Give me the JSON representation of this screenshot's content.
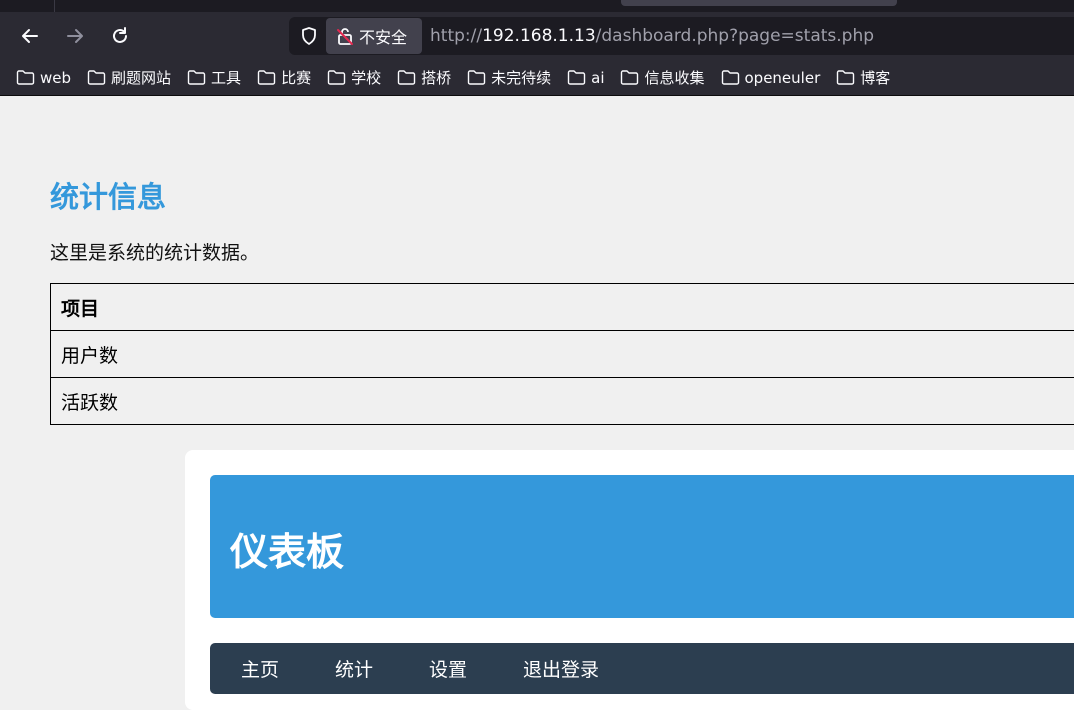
{
  "browser": {
    "url_label": "不安全",
    "url_scheme": "http://",
    "url_host": "192.168.1.13",
    "url_path": "/dashboard.php?page=stats.php",
    "colors": {
      "chrome": "#2b2a33",
      "urlbar": "#1c1b22",
      "text": "#fbfbfe"
    }
  },
  "bookmarks": [
    {
      "label": "web",
      "icon": "folder-icon"
    },
    {
      "label": "刷题网站",
      "icon": "folder-icon"
    },
    {
      "label": "工具",
      "icon": "folder-icon"
    },
    {
      "label": "比赛",
      "icon": "folder-icon"
    },
    {
      "label": "学校",
      "icon": "folder-icon"
    },
    {
      "label": "搭桥",
      "icon": "folder-icon"
    },
    {
      "label": "未完待续",
      "icon": "folder-icon"
    },
    {
      "label": "ai",
      "icon": "folder-icon"
    },
    {
      "label": "信息收集",
      "icon": "folder-icon"
    },
    {
      "label": "openeuler",
      "icon": "folder-icon"
    },
    {
      "label": "博客",
      "icon": "folder-icon"
    }
  ],
  "stats": {
    "title": "统计信息",
    "description": "这里是系统的统计数据。",
    "table": {
      "header": "项目",
      "rows": [
        "用户数",
        "活跃数"
      ]
    }
  },
  "dashboard": {
    "title": "仪表板",
    "nav": [
      "主页",
      "统计",
      "设置",
      "退出登录"
    ],
    "colors": {
      "header": "#3498db",
      "nav": "#2c3e50"
    }
  }
}
